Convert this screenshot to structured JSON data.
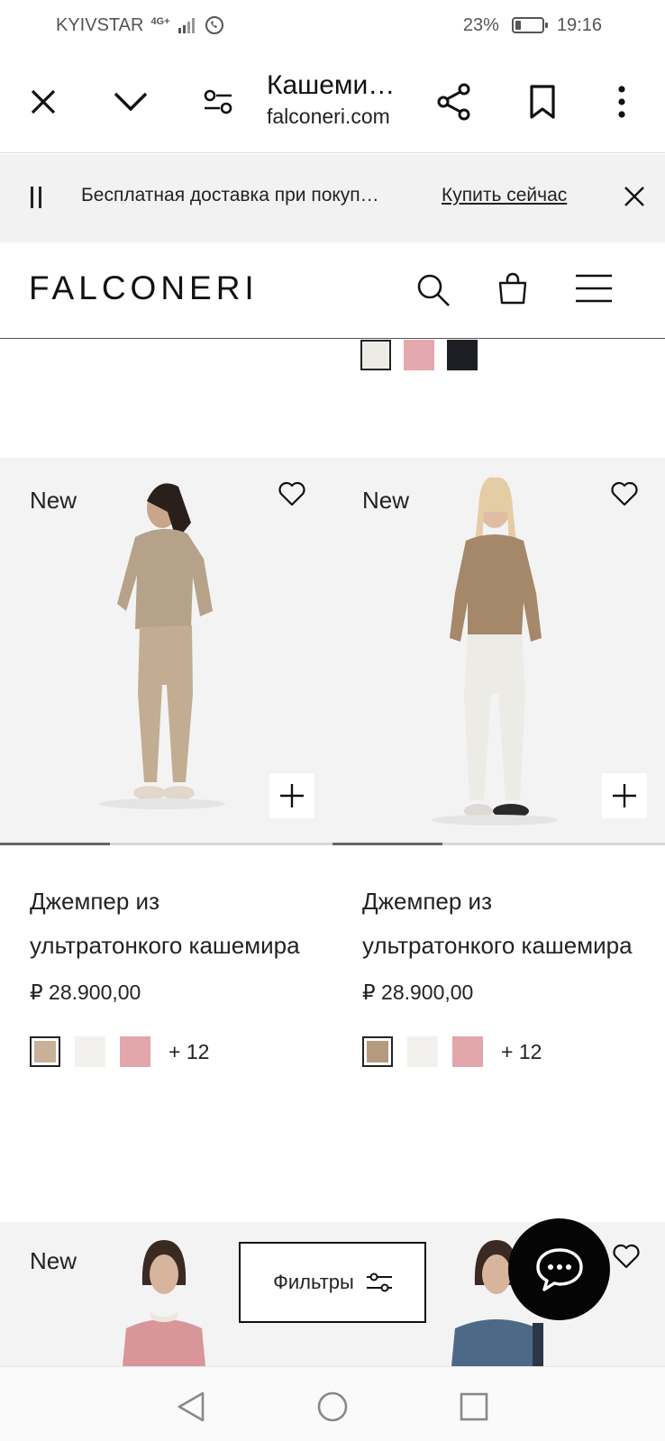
{
  "status_bar": {
    "carrier": "KYIVSTAR",
    "network": "4G+",
    "battery_percent": "23%",
    "battery_level": 0.23,
    "time": "19:16"
  },
  "browser": {
    "tab_title": "Кашеми…",
    "domain": "falconeri.com",
    "icons": [
      "close-icon",
      "chevron-down-icon",
      "page-settings-icon",
      "share-icon",
      "bookmark-icon",
      "more-vertical-icon"
    ]
  },
  "promo": {
    "text": "Бесплатная доставка при покуп…",
    "link": "Купить сейчас"
  },
  "header": {
    "logo": "FALCONERI",
    "icons": [
      "search-icon",
      "shopping-bag-icon",
      "menu-icon"
    ]
  },
  "prev_row_swatches": [
    "#ecebe6",
    "#e4a9ae",
    "#1e1f24"
  ],
  "products": [
    {
      "badge": "New",
      "name": "Джемпер из ультратонкого кашемира",
      "price": "₽ 28.900,00",
      "swatches": [
        "#c7b199",
        "#f2f1ed",
        "#e2a6ab"
      ],
      "more_colors": "+ 12",
      "image_progress": 0.33
    },
    {
      "badge": "New",
      "name": "Джемпер из ультратонкого кашемира",
      "price": "₽ 28.900,00",
      "swatches": [
        "#b59a7f",
        "#f2f1ed",
        "#e2a6ab"
      ],
      "more_colors": "+ 12",
      "image_progress": 0.33
    }
  ],
  "bottom_row": {
    "badge": "New"
  },
  "filters_button": "Фильтры",
  "colors": {
    "text": "#111111",
    "image_bg": "#f3f3f3",
    "promo_bg": "#f2f2f2",
    "fab": "#050505"
  }
}
